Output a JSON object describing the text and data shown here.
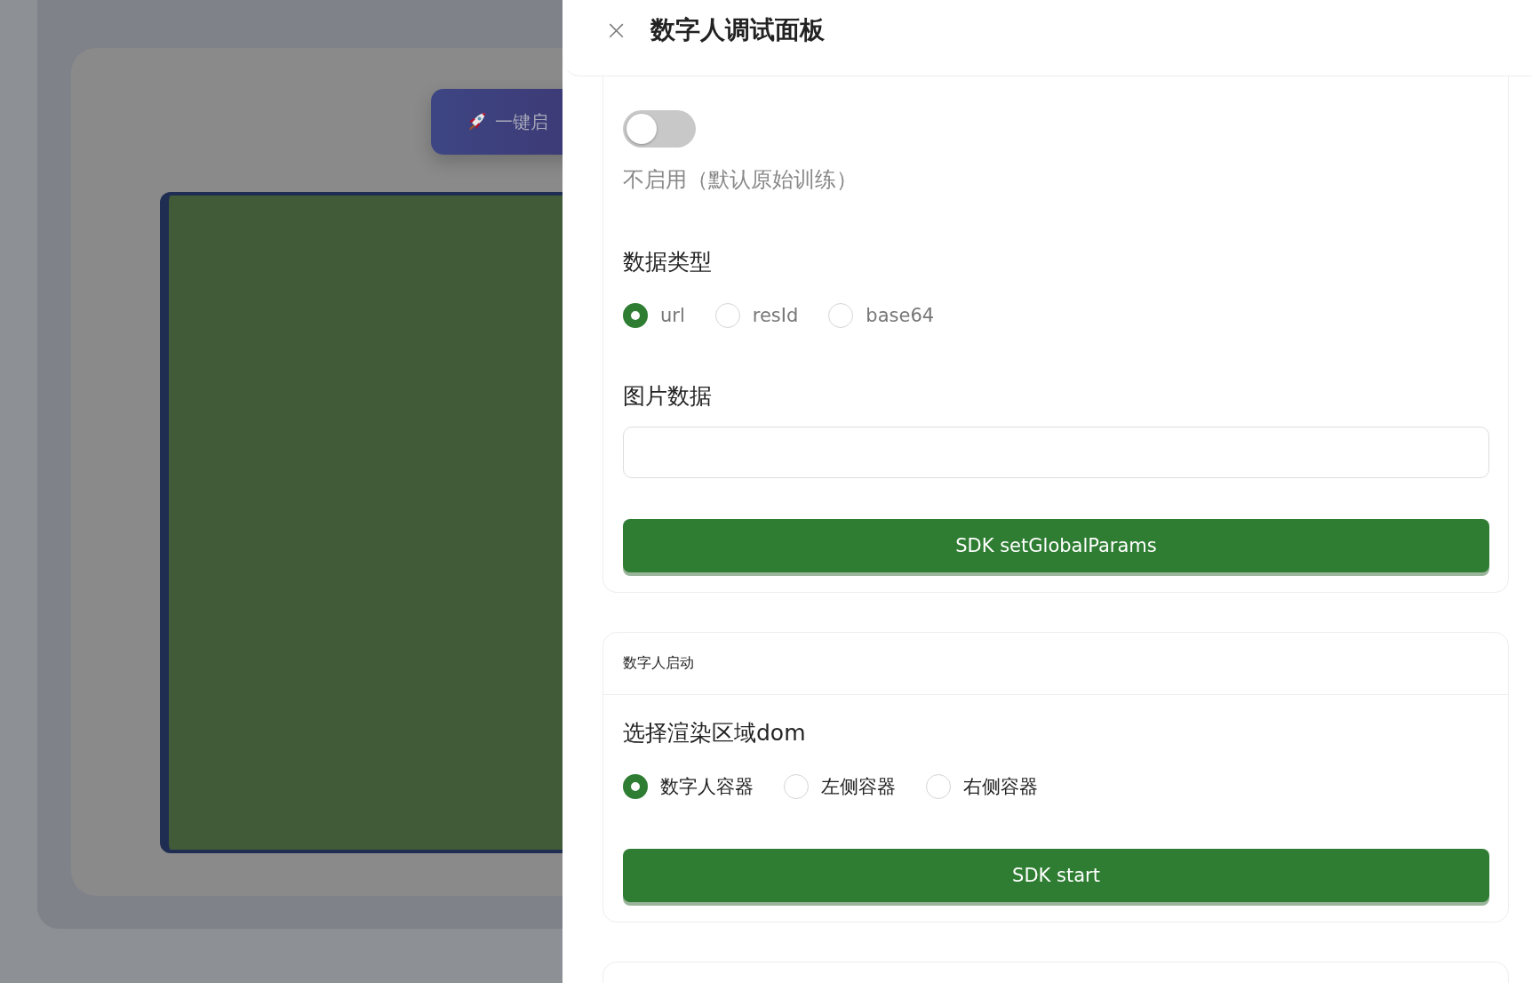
{
  "background": {
    "launch_button": "一键启"
  },
  "drawer": {
    "title": "数字人调试面板",
    "close": "×"
  },
  "background_card": {
    "toggle": {
      "on": false
    },
    "toggle_caption": "不启用（默认原始训练）",
    "data_type": {
      "label": "数据类型",
      "options": [
        {
          "label": "url",
          "selected": true
        },
        {
          "label": "resId",
          "selected": false
        },
        {
          "label": "base64",
          "selected": false
        }
      ]
    },
    "image_data": {
      "label": "图片数据"
    },
    "button": "SDK setGlobalParams"
  },
  "start_card": {
    "header": "数字人启动",
    "render_area": {
      "label": "选择渲染区域dom",
      "options": [
        {
          "label": "数字人容器",
          "selected": true
        },
        {
          "label": "左侧容器",
          "selected": false
        },
        {
          "label": "右侧容器",
          "selected": false
        }
      ]
    },
    "button": "SDK start"
  }
}
